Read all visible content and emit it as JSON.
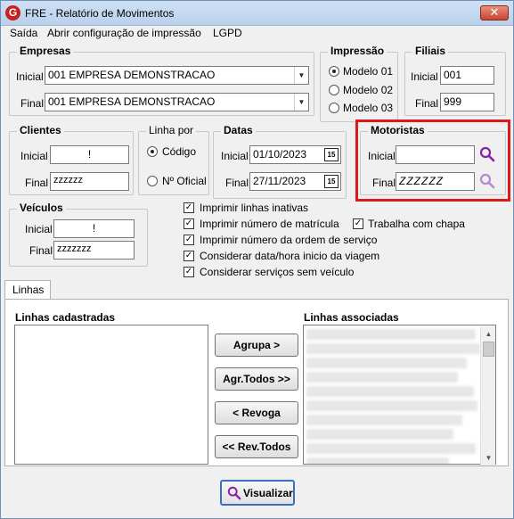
{
  "window": {
    "title": "FRE - Relatório de Movimentos",
    "app_icon": "G",
    "close_label": "✕"
  },
  "menu": [
    "Saída",
    "Abrir configuração de impressão",
    "LGPD"
  ],
  "empresas": {
    "title": "Empresas",
    "inicial_label": "Inicial",
    "inicial_value": "001 EMPRESA DEMONSTRACAO",
    "final_label": "Final",
    "final_value": "001 EMPRESA DEMONSTRACAO"
  },
  "impressao": {
    "title": "Impressão",
    "options": [
      "Modelo 01",
      "Modelo 02",
      "Modelo 03"
    ],
    "selected": "Modelo 01"
  },
  "filiais": {
    "title": "Filiais",
    "inicial_label": "Inicial",
    "inicial_value": "001",
    "final_label": "Final",
    "final_value": "999"
  },
  "clientes": {
    "title": "Clientes",
    "inicial_label": "Inicial",
    "inicial_value": "!",
    "final_label": "Final",
    "final_value": "zzzzzz"
  },
  "linha_por": {
    "title": "Linha por",
    "options": [
      "Código",
      "Nº Oficial"
    ],
    "selected": "Código"
  },
  "datas": {
    "title": "Datas",
    "inicial_label": "Inicial",
    "inicial_value": "01/10/2023",
    "final_label": "Final",
    "final_value": "27/11/2023",
    "calendar_glyph": "15"
  },
  "motoristas": {
    "title": "Motoristas",
    "inicial_label": "Inicial",
    "inicial_value": "",
    "final_label": "Final",
    "final_value": "ZZZZZZ"
  },
  "veiculos": {
    "title": "Veículos",
    "inicial_label": "Inicial",
    "inicial_value": "!",
    "final_label": "Final",
    "final_value": "zzzzzzz"
  },
  "options": {
    "imprimir_linhas_inativas": "Imprimir linhas inativas",
    "imprimir_matricula": "Imprimir número de matrícula",
    "imprimir_ordem_servico": "Imprimir número da ordem de serviço",
    "considerar_data_hora": "Considerar data/hora inicio da viagem",
    "considerar_sem_veiculo": "Considerar serviços sem veículo",
    "trabalha_com_chapa": "Trabalha com chapa"
  },
  "tabs": {
    "linhas": "Linhas"
  },
  "linhas": {
    "cadastradas_title": "Linhas cadastradas",
    "associadas_title": "Linhas associadas",
    "buttons": {
      "agrupa": "Agrupa >",
      "agr_todos": "Agr.Todos >>",
      "revoga": "< Revoga",
      "rev_todos": "<< Rev.Todos"
    }
  },
  "visualizar_label": "Visualizar"
}
